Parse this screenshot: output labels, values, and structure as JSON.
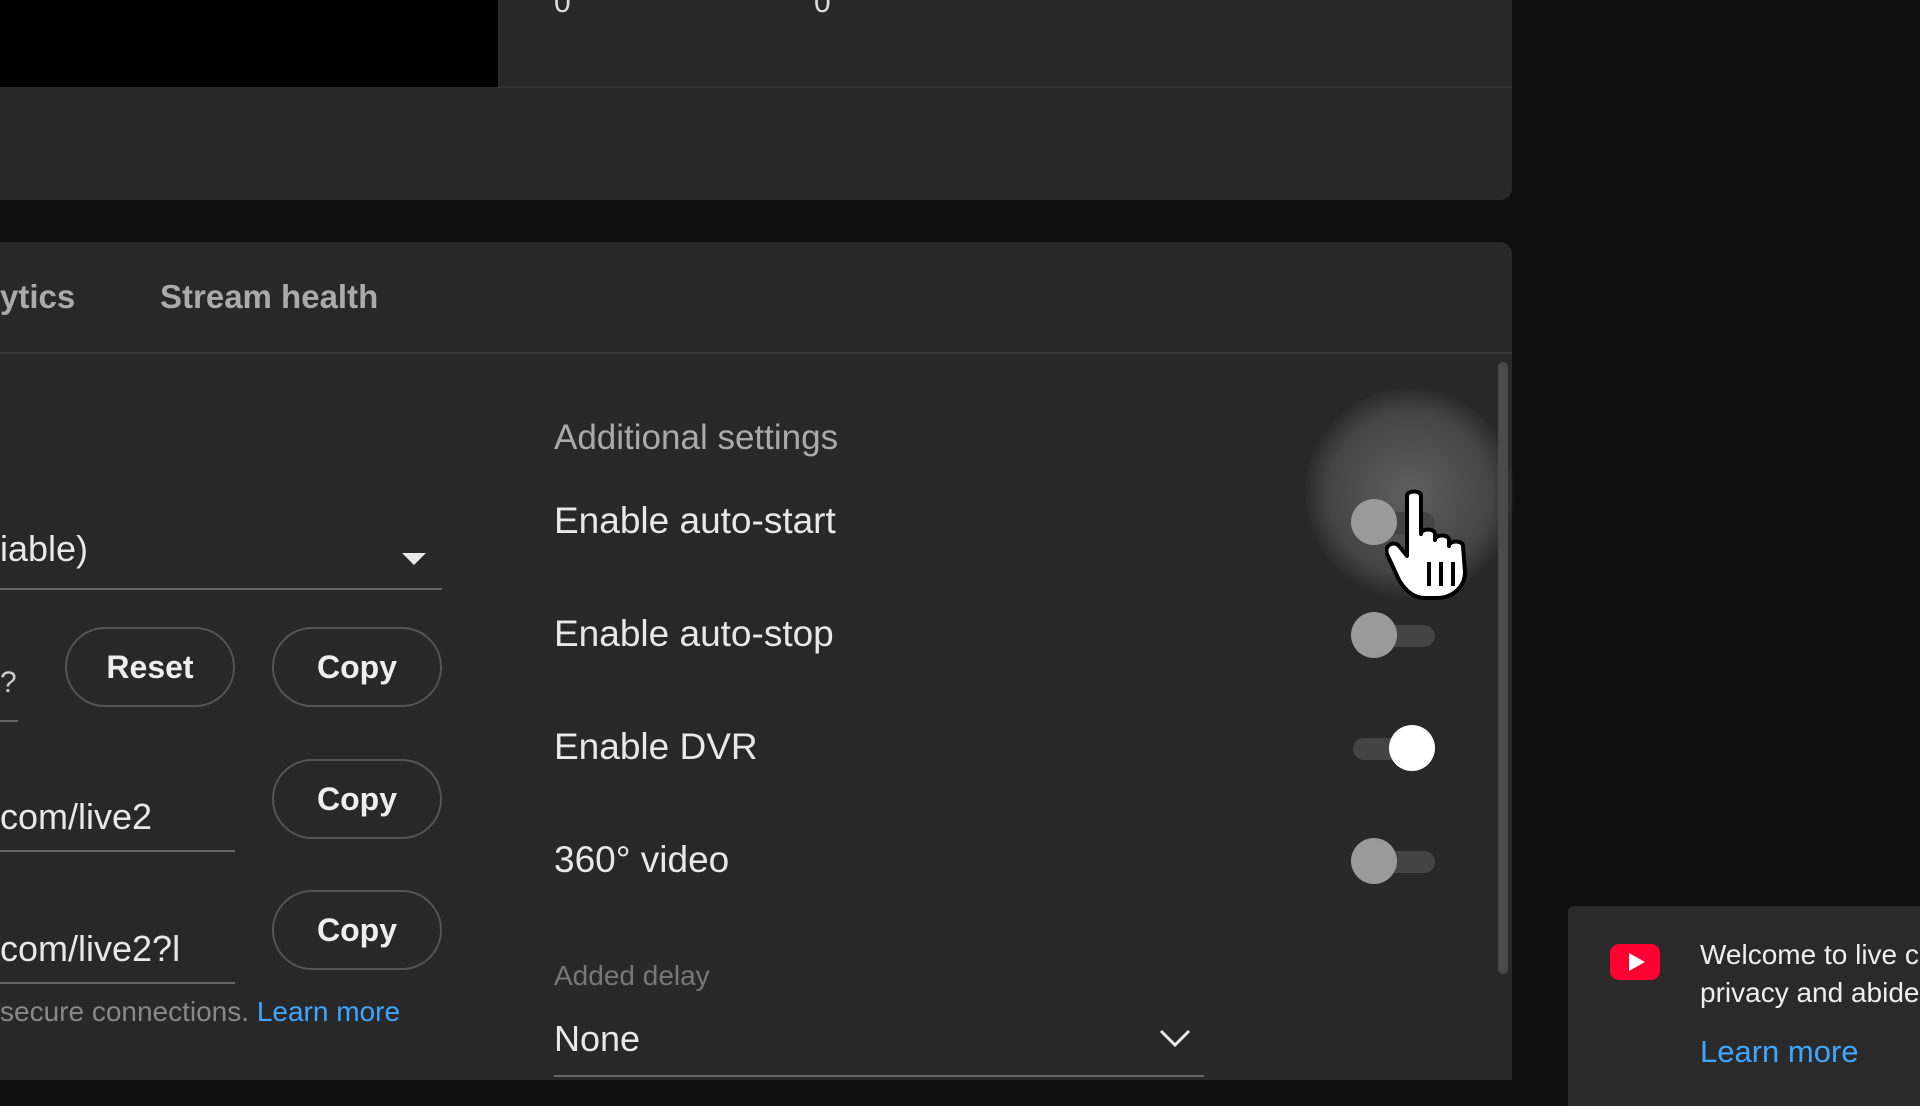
{
  "top_stats": {
    "value_1": "0",
    "value_2": "0"
  },
  "tabs": [
    {
      "label": "ytics"
    },
    {
      "label": "Stream health"
    }
  ],
  "stream_key": {
    "dropdown_value": "iable)",
    "key_partial": "?",
    "reset_label": "Reset",
    "copy_label": "Copy"
  },
  "urls": [
    {
      "value": "com/live2",
      "copy_label": "Copy"
    },
    {
      "value": "com/live2?l",
      "copy_label": "Copy"
    }
  ],
  "hint": {
    "text": "secure connections.",
    "link": "Learn more"
  },
  "additional_settings": {
    "title": "Additional settings",
    "items": [
      {
        "label": "Enable auto-start",
        "enabled": false
      },
      {
        "label": "Enable auto-stop",
        "enabled": false
      },
      {
        "label": "Enable DVR",
        "enabled": true
      },
      {
        "label": "360° video",
        "enabled": false
      }
    ],
    "delay_label": "Added delay",
    "delay_value": "None"
  },
  "toast": {
    "line1": "Welcome to live c",
    "line2": "privacy and abide",
    "link": "Learn more"
  },
  "colors": {
    "accent": "#3ea6ff",
    "brand": "#ff0033",
    "panel": "#282828"
  }
}
